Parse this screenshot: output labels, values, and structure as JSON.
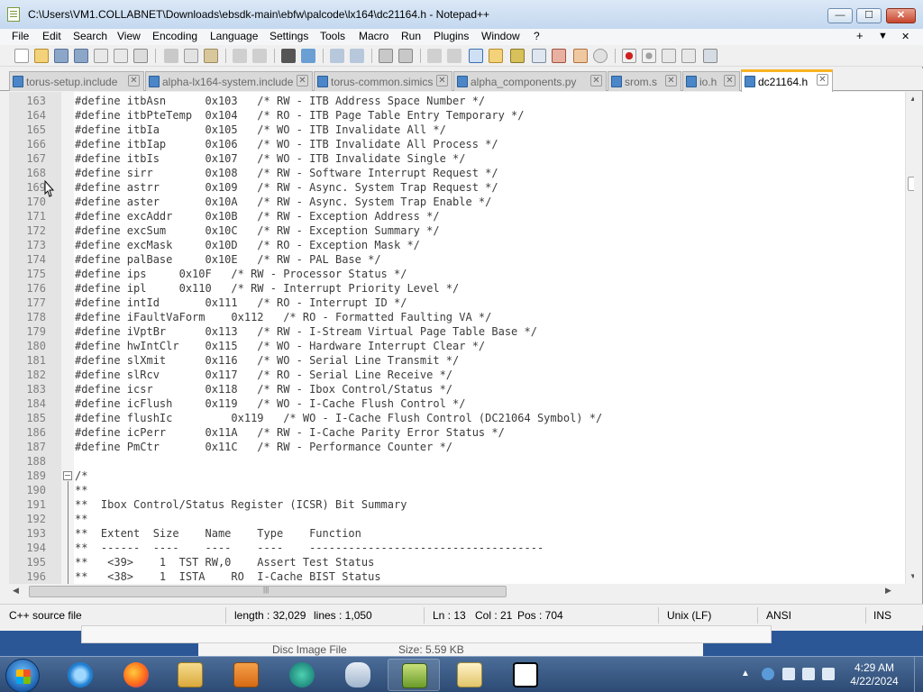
{
  "window": {
    "title": "C:\\Users\\VM1.COLLABNET\\Downloads\\ebsdk-main\\ebfw\\palcode\\lx164\\dc21164.h - Notepad++",
    "minimize_glyph": "—",
    "maximize_glyph": "☐",
    "close_glyph": "✕"
  },
  "menubar": {
    "items": [
      "File",
      "Edit",
      "Search",
      "View",
      "Encoding",
      "Language",
      "Settings",
      "Tools",
      "Macro",
      "Run",
      "Plugins",
      "Window",
      "?"
    ],
    "right": [
      "+",
      "▼",
      "✕"
    ]
  },
  "toolbar": {
    "icons": [
      "new-file-icon",
      "open-file-icon",
      "save-icon",
      "save-all-icon",
      "close-icon",
      "close-all-icon",
      "print-icon",
      "cut-icon",
      "copy-icon",
      "paste-icon",
      "undo-icon",
      "redo-icon",
      "find-icon",
      "replace-icon",
      "zoom-in-icon",
      "zoom-out-icon",
      "sync-vertical-icon",
      "sync-horizontal-icon",
      "word-wrap-icon",
      "show-all-characters-icon",
      "indent-guide-icon",
      "udl-icon",
      "doc-map-icon",
      "function-list-icon",
      "folder-workspace-icon",
      "monitoring-icon",
      "record-macro-icon",
      "stop-macro-icon",
      "play-macro-icon",
      "run-macro-multiple-icon",
      "save-macro-icon"
    ]
  },
  "tabs": [
    {
      "label": "torus-setup.include",
      "active": false
    },
    {
      "label": "alpha-lx164-system.include",
      "active": false
    },
    {
      "label": "torus-common.simics",
      "active": false
    },
    {
      "label": "alpha_components.py",
      "active": false
    },
    {
      "label": "srom.s",
      "active": false
    },
    {
      "label": "io.h",
      "active": false
    },
    {
      "label": "dc21164.h",
      "active": true
    }
  ],
  "tab_close_glyph": "✕",
  "editor": {
    "lines": [
      {
        "n": "163",
        "text": "#define itbAsn      0x103   /* RW - ITB Address Space Number */"
      },
      {
        "n": "164",
        "text": "#define itbPteTemp  0x104   /* RO - ITB Page Table Entry Temporary */"
      },
      {
        "n": "165",
        "text": "#define itbIa       0x105   /* WO - ITB Invalidate All */"
      },
      {
        "n": "166",
        "text": "#define itbIap      0x106   /* WO - ITB Invalidate All Process */"
      },
      {
        "n": "167",
        "text": "#define itbIs       0x107   /* WO - ITB Invalidate Single */"
      },
      {
        "n": "168",
        "text": "#define sirr        0x108   /* RW - Software Interrupt Request */"
      },
      {
        "n": "169",
        "text": "#define astrr       0x109   /* RW - Async. System Trap Request */"
      },
      {
        "n": "170",
        "text": "#define aster       0x10A   /* RW - Async. System Trap Enable */"
      },
      {
        "n": "171",
        "text": "#define excAddr     0x10B   /* RW - Exception Address */"
      },
      {
        "n": "172",
        "text": "#define excSum      0x10C   /* RW - Exception Summary */"
      },
      {
        "n": "173",
        "text": "#define excMask     0x10D   /* RO - Exception Mask */"
      },
      {
        "n": "174",
        "text": "#define palBase     0x10E   /* RW - PAL Base */"
      },
      {
        "n": "175",
        "text": "#define ips     0x10F   /* RW - Processor Status */"
      },
      {
        "n": "176",
        "text": "#define ipl     0x110   /* RW - Interrupt Priority Level */"
      },
      {
        "n": "177",
        "text": "#define intId       0x111   /* RO - Interrupt ID */"
      },
      {
        "n": "178",
        "text": "#define iFaultVaForm    0x112   /* RO - Formatted Faulting VA */"
      },
      {
        "n": "179",
        "text": "#define iVptBr      0x113   /* RW - I-Stream Virtual Page Table Base */"
      },
      {
        "n": "180",
        "text": "#define hwIntClr    0x115   /* WO - Hardware Interrupt Clear */"
      },
      {
        "n": "181",
        "text": "#define slXmit      0x116   /* WO - Serial Line Transmit */"
      },
      {
        "n": "182",
        "text": "#define slRcv       0x117   /* RO - Serial Line Receive */"
      },
      {
        "n": "183",
        "text": "#define icsr        0x118   /* RW - Ibox Control/Status */"
      },
      {
        "n": "184",
        "text": "#define icFlush     0x119   /* WO - I-Cache Flush Control */"
      },
      {
        "n": "185",
        "text": "#define flushIc         0x119   /* WO - I-Cache Flush Control (DC21064 Symbol) */"
      },
      {
        "n": "186",
        "text": "#define icPerr      0x11A   /* RW - I-Cache Parity Error Status */"
      },
      {
        "n": "187",
        "text": "#define PmCtr       0x11C   /* RW - Performance Counter */"
      },
      {
        "n": "188",
        "text": ""
      },
      {
        "n": "189",
        "text": "/*"
      },
      {
        "n": "190",
        "text": "**"
      },
      {
        "n": "191",
        "text": "**  Ibox Control/Status Register (ICSR) Bit Summary"
      },
      {
        "n": "192",
        "text": "**"
      },
      {
        "n": "193",
        "text": "**  Extent  Size    Name    Type    Function"
      },
      {
        "n": "194",
        "text": "**  ------  ----    ----    ----    ------------------------------------"
      },
      {
        "n": "195",
        "text": "**   <39>    1  TST RW,0    Assert Test Status"
      },
      {
        "n": "196",
        "text": "**   <38>    1  ISTA    RO  I-Cache BIST Status"
      }
    ]
  },
  "statusbar": {
    "filetype": "C++ source file",
    "length": "length : 32,029",
    "lines": "lines : 1,050",
    "ln": "Ln : 13",
    "col": "Col : 21",
    "pos": "Pos : 704",
    "eol": "Unix (LF)",
    "encoding": "ANSI",
    "mode": "INS"
  },
  "background_window": {
    "row1": "Disc Image File",
    "row1_size": "Size: 5.59 KB"
  },
  "taskbar": {
    "apps": [
      "start-button",
      "internet-explorer",
      "firefox",
      "file-explorer",
      "media-player",
      "simics",
      "wireshark",
      "notepad-plus-plus",
      "hxd",
      "7-zip"
    ],
    "time": "4:29 AM",
    "date": "4/22/2024"
  },
  "colors": {
    "tab_accent": "#fab422",
    "code_text": "#3b3b3b",
    "line_numbers": "#808080"
  }
}
